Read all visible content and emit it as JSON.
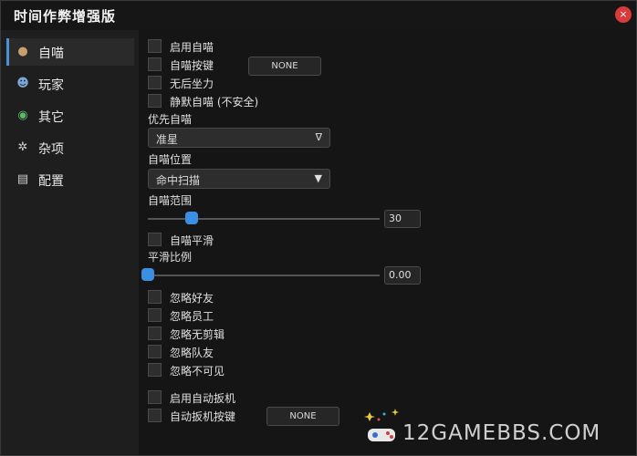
{
  "window": {
    "title": "时间作弊增强版",
    "close_glyph": "×"
  },
  "sidebar": {
    "items": [
      {
        "label": "自喵",
        "icon": "bomb-icon",
        "glyph": "💣",
        "active": true
      },
      {
        "label": "玩家",
        "icon": "person-icon",
        "glyph": "👤"
      },
      {
        "label": "其它",
        "icon": "globe-icon",
        "glyph": "🌐"
      },
      {
        "label": "杂项",
        "icon": "gear-icon",
        "glyph": "⚙"
      },
      {
        "label": "配置",
        "icon": "database-icon",
        "glyph": "🛢"
      }
    ]
  },
  "main": {
    "enable_aim": {
      "label": "启用自喵",
      "checked": false
    },
    "aim_key": {
      "label": "自喵按键",
      "checked": false,
      "key": "NONE"
    },
    "no_recoil": {
      "label": "无后坐力",
      "checked": false
    },
    "silent_aim": {
      "label": "静默自喵 (不安全)",
      "checked": false
    },
    "priority": {
      "label": "优先自喵",
      "value": "准星",
      "arrow": "∇"
    },
    "aim_pos": {
      "label": "自喵位置",
      "value": "命中扫描",
      "arrow": "▼"
    },
    "aim_range": {
      "label": "自喵范围",
      "value": "30",
      "fraction": 0.17
    },
    "aim_smooth": {
      "label": "自喵平滑",
      "checked": false
    },
    "smooth_ratio": {
      "label": "平滑比例",
      "value": "0.00",
      "fraction": 0.0
    },
    "ignore": [
      {
        "label": "忽略好友"
      },
      {
        "label": "忽略员工"
      },
      {
        "label": "忽略无剪辑"
      },
      {
        "label": "忽略队友"
      },
      {
        "label": "忽略不可见"
      }
    ],
    "auto_trigger": {
      "label": "启用自动扳机",
      "checked": false
    },
    "trigger_key": {
      "label": "自动扳机按键",
      "checked": false,
      "key": "NONE"
    }
  },
  "watermark": {
    "text": "12GAMEBBS.COM"
  }
}
